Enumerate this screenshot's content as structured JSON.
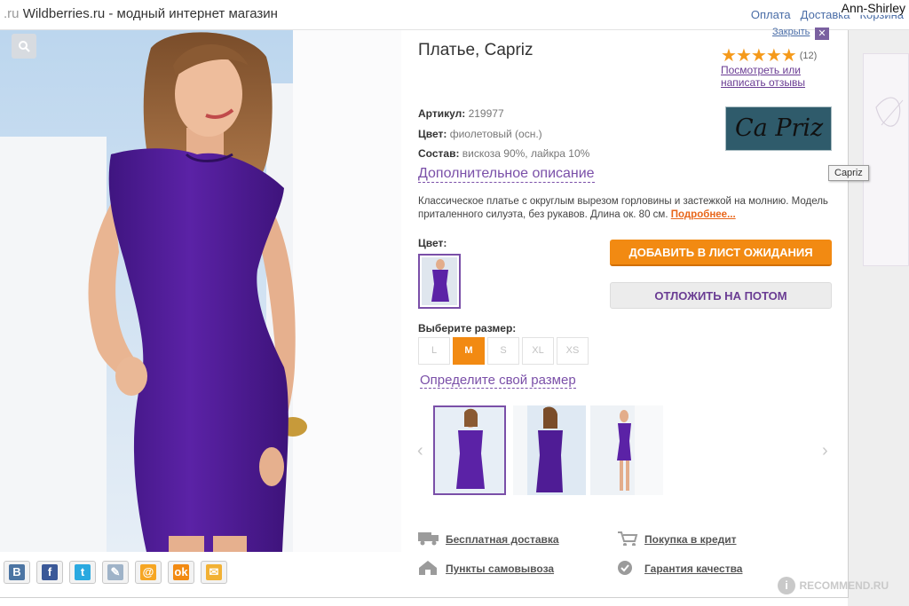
{
  "browser": {
    "site_name": "Wildberries.ru",
    "site_tagline": " - модный интернет магазин",
    "url_fragment": ".ru",
    "top_links": [
      "Оплата",
      "Доставка",
      "Корзина"
    ],
    "user_name": "Ann-Shirley"
  },
  "product": {
    "title": "Платье, Capriz",
    "close_label": "Закрыть",
    "rating_stars": 5,
    "reviews_count": "(12)",
    "reviews_link": "Посмотреть или написать отзывы",
    "brand_logo_text": "Ca Priz",
    "brand_tooltip": "Capriz",
    "specs": {
      "article_label": "Артикул:",
      "article_value": "219977",
      "color_label": "Цвет:",
      "color_value": "фиолетовый (осн.)",
      "composition_label": "Состав:",
      "composition_value": "вискоза 90%, лайкра 10%"
    },
    "additional_description": "Дополнительное описание",
    "description": "Классическое платье с округлым вырезом горловины и застежкой на молнию. Модель приталенного силуэта, без рукавов. Длина ок. 80 см.",
    "more_link": "Подробнее...",
    "color_section_label": "Цвет:",
    "buttons": {
      "add_wait": "ДОБАВИТЬ В ЛИСТ ОЖИДАНИЯ",
      "later": "ОТЛОЖИТЬ НА ПОТОМ"
    },
    "size_label": "Выберите размер:",
    "sizes": [
      "L",
      "M",
      "S",
      "XL",
      "XS"
    ],
    "selected_size": "M",
    "find_size": "Определите свой размер"
  },
  "features": [
    "Бесплатная доставка",
    "Покупка в кредит",
    "Пункты самовывоза",
    "Гарантия качества"
  ],
  "watermark": "RECOMMEND.RU",
  "colors": {
    "accent_orange": "#f28a12",
    "accent_purple": "#7a4fa8",
    "dress_purple": "#5a1f9e",
    "link_blue": "#4a6da7"
  }
}
